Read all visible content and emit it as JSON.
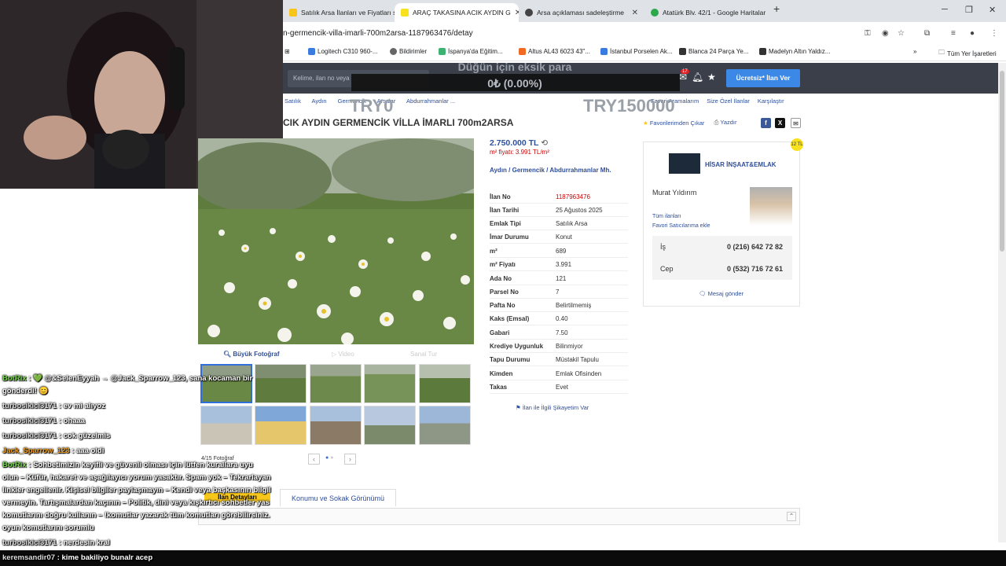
{
  "browser": {
    "tabs": [
      {
        "label": "Satılık Arsa İlanları ve Fiyatları s",
        "color": "#f8c61b"
      },
      {
        "label": "ARAÇ TAKASINA ACIK AYDIN G",
        "color": "#f8e21d"
      },
      {
        "label": "Arsa açıklaması sadeleştirme",
        "color": "#444444"
      },
      {
        "label": "Atatürk Blv. 42/1 - Google Haritalar",
        "color": "#2aa84a"
      }
    ],
    "new_tab": "+",
    "url": "n-germencik-villa-imarli-700m2arsa-1187963476/detay",
    "bookmarks": [
      "Logitech C310 960-...",
      "Bildirimler",
      "İspanya'da Eğitim...",
      "Altus AL43 6023 43\"...",
      "İstanbul Porselen Ak...",
      "Blanca 24 Parça Ye...",
      "Madelyn Altın Yaldız..."
    ],
    "all_bookmarks": "Tüm Yer İşaretleri"
  },
  "site": {
    "search_placeholder": "Kelime, ilan no veya ...",
    "notif_count": "17",
    "free_ad_button": "Ücretsiz* İlan Ver",
    "breadcrumbs": [
      "Satılık",
      "Aydın",
      "Germencik",
      "Arsalar",
      "Abdurrahmanlar ..."
    ],
    "top_nav": [
      "Favori Aramalarım",
      "Size Özel İlanlar",
      "Karşılaştır"
    ],
    "title": "CIK AYDIN GERMENCİK VİLLA İMARLI 700m2ARSA",
    "fav_remove": "Favorilerimden Çıkar",
    "print": "Yazdır"
  },
  "overlay": {
    "goal_title": "Düğün için eksik para",
    "goal_value": "0₺ (0.00%)",
    "left_label": "TRY0",
    "right_label": "TRY150000"
  },
  "listing": {
    "price": "2.750.000 TL",
    "m2_price": "m² fiyatı: 3.991 TL/m²",
    "location": "Aydın  /  Germencik  /  Abdurrahmanlar Mh.",
    "photo_tabs": [
      "Büyük Fotoğraf",
      "Video",
      "Sanal Tur"
    ],
    "photo_count": "4/15 Fotoğraf",
    "details": [
      {
        "k": "İlan No",
        "v": "1187963476"
      },
      {
        "k": "İlan Tarihi",
        "v": "25 Ağustos 2025"
      },
      {
        "k": "Emlak Tipi",
        "v": "Satılık Arsa"
      },
      {
        "k": "İmar Durumu",
        "v": "Konut"
      },
      {
        "k": "m²",
        "v": "689"
      },
      {
        "k": "m² Fiyatı",
        "v": "3.991"
      },
      {
        "k": "Ada No",
        "v": "121"
      },
      {
        "k": "Parsel No",
        "v": "7"
      },
      {
        "k": "Pafta No",
        "v": "Belirtilmemiş"
      },
      {
        "k": "Kaks (Emsal)",
        "v": "0.40"
      },
      {
        "k": "Gabari",
        "v": "7.50"
      },
      {
        "k": "Krediye Uygunluk",
        "v": "Bilinmiyor"
      },
      {
        "k": "Tapu Durumu",
        "v": "Müstakil Tapulu"
      },
      {
        "k": "Kimden",
        "v": "Emlak Ofisinden"
      },
      {
        "k": "Takas",
        "v": "Evet"
      }
    ],
    "complain": "İlan ile İlgili Şikayetim Var",
    "tab_details": "İlan Detayları",
    "tab_location": "Konumu ve Sokak Görünümü"
  },
  "seller": {
    "store": "HİSAR İNŞAAT&EMLAK",
    "name": "Murat Yıldırım",
    "all_ads": "Tüm ilanları",
    "add_fav": "Favori Satıcılarıma ekle",
    "phones": [
      {
        "k": "İş",
        "v": "0 (216) 642 72 82"
      },
      {
        "k": "Cep",
        "v": "0 (532) 716 72 61"
      }
    ],
    "message": "Mesaj gönder",
    "badge": "12 TL"
  },
  "chat": [
    {
      "user": "BotRix",
      "ucls": "u1",
      "text": " : 💚 @&SelenEyyah → @Jack_Sparrow_123, sana kocaman bir"
    },
    {
      "user": "",
      "ucls": "u3",
      "text": "gönderdi! 😊"
    },
    {
      "user": "turbosikici3171",
      "ucls": "u3",
      "text": " : ev mi alıyoz"
    },
    {
      "user": "turbosikici3171",
      "ucls": "u3",
      "text": " : ohaaa"
    },
    {
      "user": "turbosikici3171",
      "ucls": "u3",
      "text": " : cok güzelmis"
    },
    {
      "user": "Jack_Sparrow_123",
      "ucls": "u2",
      "text": " : aaa oldi"
    },
    {
      "user": "BotRix",
      "ucls": "u1",
      "text": " : Sohbetimizin keyifli ve güvenli olması için lütfen kurallara uyu"
    },
    {
      "user": "",
      "ucls": "u3",
      "text": "olun – Küfür, hakaret ve aşağılayıcı yorum yasaktır. Spam yok – Tekrarlayan"
    },
    {
      "user": "",
      "ucls": "u3",
      "text": "linkler engellenir. Kişisel bilgiler paylaşmayın – Kendi veya başkasının bilgil"
    },
    {
      "user": "",
      "ucls": "u3",
      "text": "vermeyin. Tartışmalardan kaçının – Politik, dini veya kışkırtıcı sohbetler yas"
    },
    {
      "user": "",
      "ucls": "u3",
      "text": "komutlarını doğru kullanın – !komutlar yazarak tüm komutları görebilirsiniz."
    },
    {
      "user": "",
      "ucls": "u3",
      "text": "oyun komutlarını sorumlu"
    },
    {
      "user": "turbosikici3171",
      "ucls": "u3",
      "text": " : nerdesin kral"
    },
    {
      "user": "keremsandir07",
      "ucls": "u3",
      "text": " : kime bakiliyo bunalr acep"
    }
  ]
}
